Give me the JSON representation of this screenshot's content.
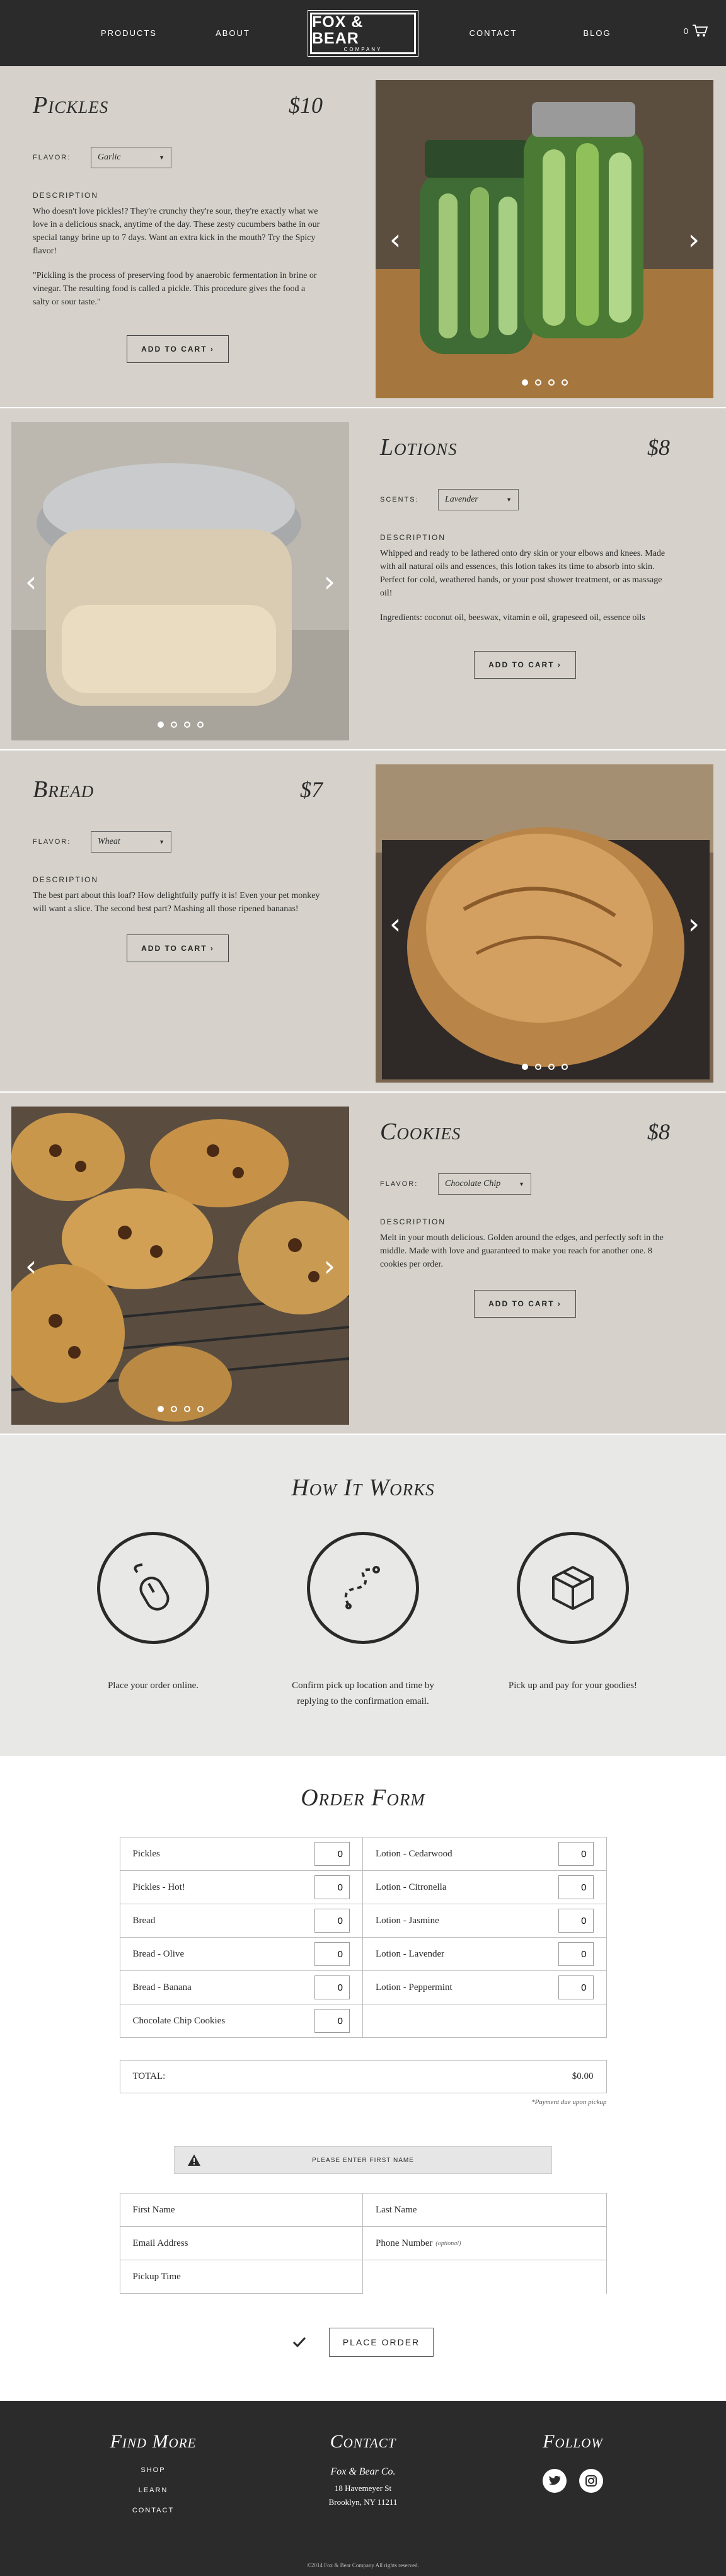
{
  "nav": {
    "products": "PRODUCTS",
    "about": "ABOUT",
    "contact": "CONTACT",
    "blog": "BLOG",
    "cart_count": "0"
  },
  "logo": {
    "line1": "FOX & BEAR",
    "line2": "COMPANY"
  },
  "products": [
    {
      "title": "Pickles",
      "price": "$10",
      "option_label": "FLAVOR:",
      "option_value": "Garlic",
      "desc_heading": "DESCRIPTION",
      "desc1": "Who doesn't love pickles!? They're crunchy they're sour, they're exactly what we love in a delicious snack, anytime of the day. These zesty cucumbers bathe in our special tangy brine up to 7 days. Want an extra kick in the mouth? Try the Spicy flavor!",
      "desc2": "\"Pickling is the process of preserving food by anaerobic fermentation in brine or vinegar. The resulting food is called a pickle. This procedure gives the food a salty or sour taste.\"",
      "button": "ADD TO CART ›"
    },
    {
      "title": "Lotions",
      "price": "$8",
      "option_label": "SCENTS:",
      "option_value": "Lavender",
      "desc_heading": "DESCRIPTION",
      "desc1": "Whipped and ready to be lathered onto dry skin or your elbows and knees. Made with all natural oils and essences, this lotion takes its time to absorb into skin. Perfect for cold, weathered hands, or your post shower treatment, or as massage oil!",
      "desc2": "Ingredients: coconut oil, beeswax, vitamin e oil, grapeseed oil, essence oils",
      "button": "ADD TO CART ›"
    },
    {
      "title": "Bread",
      "price": "$7",
      "option_label": "FLAVOR:",
      "option_value": "Wheat",
      "desc_heading": "DESCRIPTION",
      "desc1": "The best part about this loaf? How delightfully puffy it is! Even your pet monkey will want a slice. The second best part? Mashing all those ripened bananas!",
      "desc2": "",
      "button": "ADD TO CART ›"
    },
    {
      "title": "Cookies",
      "price": "$8",
      "option_label": "FLAVOR:",
      "option_value": "Chocolate Chip",
      "desc_heading": "DESCRIPTION",
      "desc1": "Melt in your mouth delicious. Golden around the edges, and perfectly soft in the middle. Made with love and guaranteed to make you reach for another one. 8 cookies per order.",
      "desc2": "",
      "button": "ADD TO CART ›"
    }
  ],
  "how": {
    "title": "How It Works",
    "steps": [
      "Place your order online.",
      "Confirm pick up location and time by replying to the confirmation email.",
      "Pick up and pay for your goodies!"
    ]
  },
  "order": {
    "title": "Order Form",
    "items": [
      {
        "name": "Pickles",
        "qty": "0"
      },
      {
        "name": "Lotion - Cedarwood",
        "qty": "0"
      },
      {
        "name": "Pickles - Hot!",
        "qty": "0"
      },
      {
        "name": "Lotion - Citronella",
        "qty": "0"
      },
      {
        "name": "Bread",
        "qty": "0"
      },
      {
        "name": "Lotion - Jasmine",
        "qty": "0"
      },
      {
        "name": "Bread - Olive",
        "qty": "0"
      },
      {
        "name": "Lotion - Lavender",
        "qty": "0"
      },
      {
        "name": "Bread - Banana",
        "qty": "0"
      },
      {
        "name": "Lotion - Peppermint",
        "qty": "0"
      },
      {
        "name": "Chocolate Chip Cookies",
        "qty": "0"
      }
    ],
    "total_label": "TOTAL:",
    "total_value": "$0.00",
    "payment_note": "*Payment due upon pickup",
    "alert": "PLEASE ENTER FIRST NAME",
    "fields": {
      "first_name": "First Name",
      "last_name": "Last Name",
      "email": "Email Address",
      "phone": "Phone Number",
      "phone_optional": "(optional)",
      "pickup_time": "Pickup Time"
    },
    "submit": "PLACE ORDER"
  },
  "footer": {
    "find_more": "Find More",
    "links": [
      "SHOP",
      "LEARN",
      "CONTACT"
    ],
    "contact_title": "Contact",
    "company": "Fox & Bear Co.",
    "address1": "18 Havemeyer St",
    "address2": "Brooklyn, NY 11211",
    "follow_title": "Follow",
    "copyright": "©2014 Fox & Bear Company All rights reserved."
  },
  "colors": {
    "header_bg": "#2b2b2b",
    "product_bg": "#d6d2cb",
    "how_bg": "#e8e8e7"
  },
  "icons": [
    "cart-icon",
    "mouse-icon",
    "route-icon",
    "box-icon",
    "warning-icon",
    "check-icon",
    "twitter-icon",
    "instagram-icon"
  ]
}
